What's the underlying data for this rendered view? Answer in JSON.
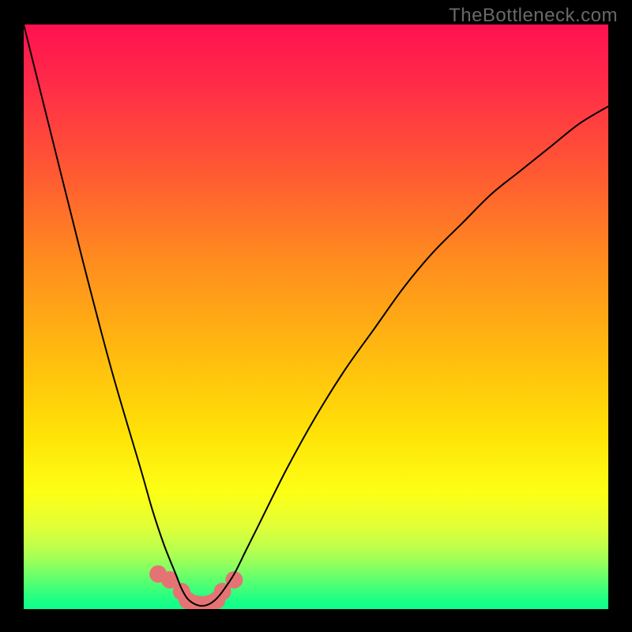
{
  "watermark": "TheBottleneck.com",
  "chart_data": {
    "type": "line",
    "title": "",
    "xlabel": "",
    "ylabel": "",
    "xlim": [
      0,
      100
    ],
    "ylim": [
      0,
      100
    ],
    "grid": false,
    "legend": false,
    "series": [
      {
        "name": "bottleneck-curve",
        "color": "#000000",
        "x": [
          0,
          5,
          10,
          15,
          20,
          22,
          24,
          26,
          27,
          28,
          29,
          30,
          31,
          32,
          33,
          34,
          36,
          38,
          40,
          45,
          50,
          55,
          60,
          65,
          70,
          75,
          80,
          85,
          90,
          95,
          100
        ],
        "values": [
          100,
          80,
          60,
          41,
          24,
          17,
          11,
          6,
          3.5,
          1.8,
          1,
          0.6,
          0.6,
          1,
          1.8,
          3,
          6,
          10,
          14,
          24,
          33,
          41,
          48,
          55,
          61,
          66,
          71,
          75,
          79,
          83,
          86
        ]
      },
      {
        "name": "bottom-markers",
        "color": "#e57373",
        "type": "scatter",
        "x": [
          23,
          25,
          27,
          28,
          29,
          30,
          31,
          32,
          33,
          34,
          36
        ],
        "values": [
          6,
          5,
          3,
          1.5,
          1,
          0.8,
          0.8,
          1,
          1.5,
          3,
          5
        ]
      }
    ],
    "background_gradient_stops": [
      {
        "pct": 0,
        "color": "#ff1151"
      },
      {
        "pct": 25,
        "color": "#ff5833"
      },
      {
        "pct": 55,
        "color": "#ffb710"
      },
      {
        "pct": 80,
        "color": "#fdff15"
      },
      {
        "pct": 93,
        "color": "#85ff62"
      },
      {
        "pct": 100,
        "color": "#0cff8c"
      }
    ]
  }
}
